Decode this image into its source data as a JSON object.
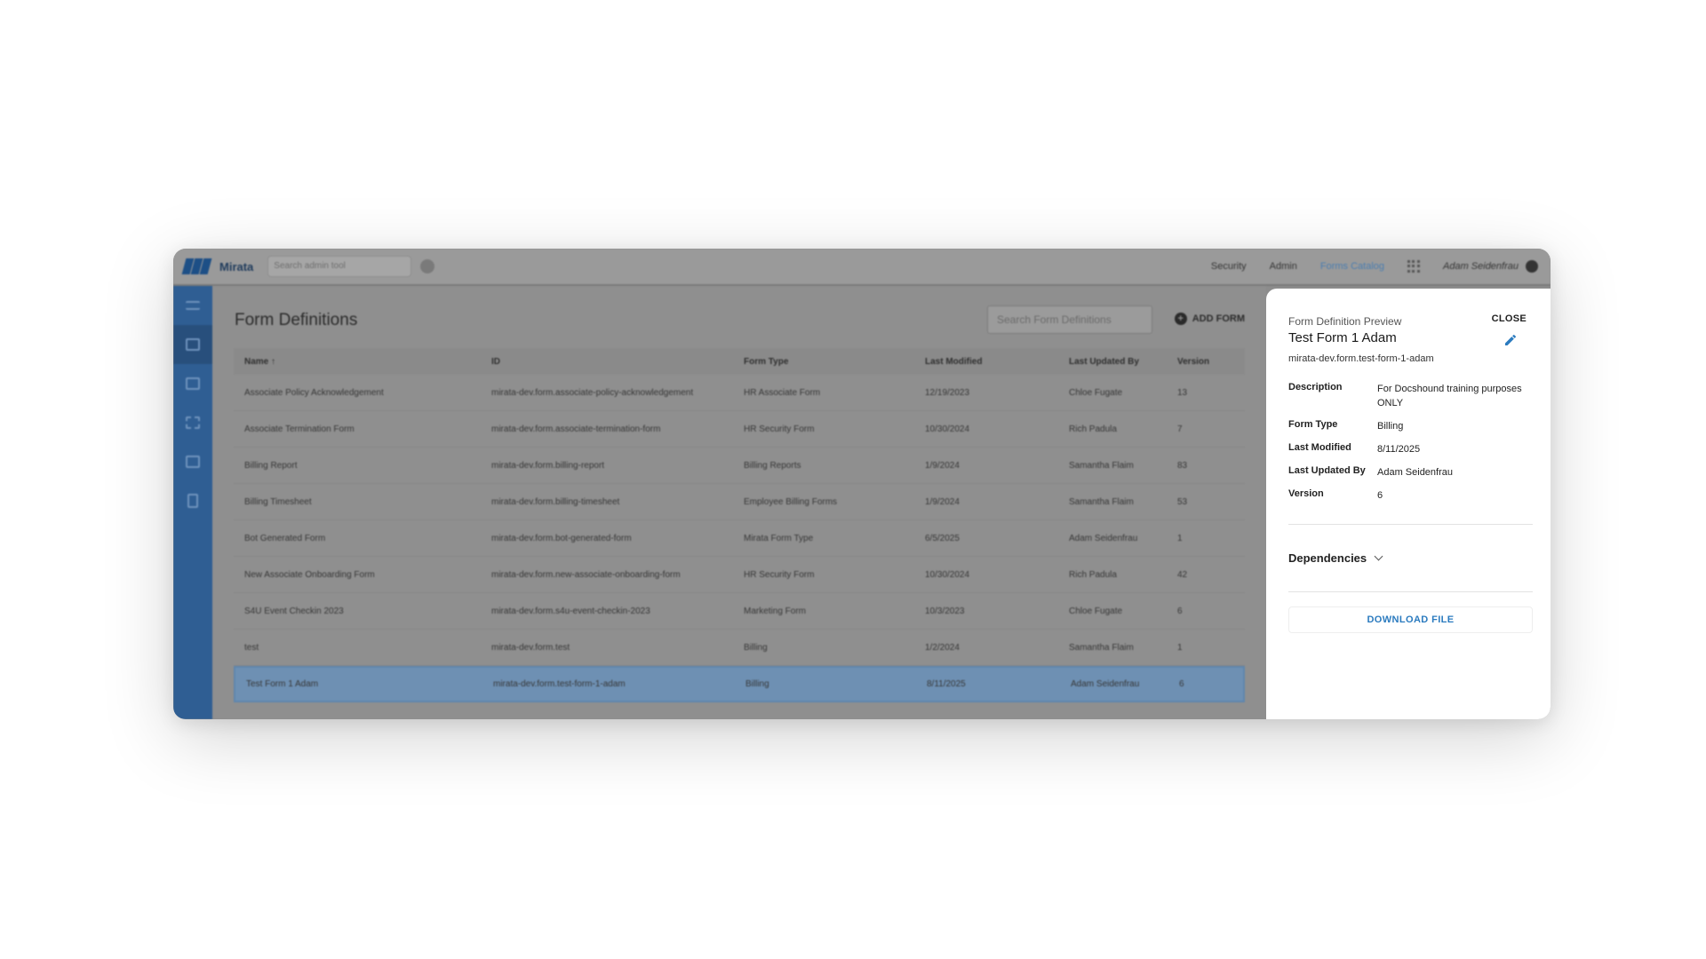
{
  "app": {
    "logo_text": "Mirata",
    "admin_search_placeholder": "Search admin tool"
  },
  "topnav": {
    "items": [
      "Security",
      "Admin",
      "Forms Catalog"
    ],
    "active": "Forms Catalog",
    "user": "Adam Seidenfrau"
  },
  "sidebar": {
    "icons": [
      "menu-icon",
      "forms-list-icon",
      "add-library-icon",
      "workflow-icon",
      "image-icon",
      "clipboard-icon"
    ]
  },
  "main": {
    "title": "Form Definitions",
    "search_placeholder": "Search Form Definitions",
    "add_form_label": "ADD FORM"
  },
  "table": {
    "columns": [
      "Name ↑",
      "ID",
      "Form Type",
      "Last Modified",
      "Last Updated By",
      "Version"
    ],
    "rows": [
      [
        "Associate Policy Acknowledgement",
        "mirata-dev.form.associate-policy-acknowledgement",
        "HR Associate Form",
        "12/19/2023",
        "Chloe Fugate",
        "13"
      ],
      [
        "Associate Termination Form",
        "mirata-dev.form.associate-termination-form",
        "HR Security Form",
        "10/30/2024",
        "Rich Padula",
        "7"
      ],
      [
        "Billing Report",
        "mirata-dev.form.billing-report",
        "Billing Reports",
        "1/9/2024",
        "Samantha Flaim",
        "83"
      ],
      [
        "Billing Timesheet",
        "mirata-dev.form.billing-timesheet",
        "Employee Billing Forms",
        "1/9/2024",
        "Samantha Flaim",
        "53"
      ],
      [
        "Bot Generated Form",
        "mirata-dev.form.bot-generated-form",
        "Mirata Form Type",
        "6/5/2025",
        "Adam Seidenfrau",
        "1"
      ],
      [
        "New Associate Onboarding Form",
        "mirata-dev.form.new-associate-onboarding-form",
        "HR Security Form",
        "10/30/2024",
        "Rich Padula",
        "42"
      ],
      [
        "S4U Event Checkin 2023",
        "mirata-dev.form.s4u-event-checkin-2023",
        "Marketing Form",
        "10/3/2023",
        "Chloe Fugate",
        "6"
      ],
      [
        "test",
        "mirata-dev.form.test",
        "Billing",
        "1/2/2024",
        "Samantha Flaim",
        "1"
      ],
      [
        "Test Form 1 Adam",
        "mirata-dev.form.test-form-1-adam",
        "Billing",
        "8/11/2025",
        "Adam Seidenfrau",
        "6"
      ]
    ],
    "selected_index": 8
  },
  "preview": {
    "eyebrow": "Form Definition Preview",
    "title": "Test Form 1 Adam",
    "id": "mirata-dev.form.test-form-1-adam",
    "close_label": "CLOSE",
    "details": [
      {
        "key": "Description",
        "value": "For Docshound training purposes ONLY"
      },
      {
        "key": "Form Type",
        "value": "Billing"
      },
      {
        "key": "Last Modified",
        "value": "8/11/2025"
      },
      {
        "key": "Last Updated By",
        "value": "Adam Seidenfrau"
      },
      {
        "key": "Version",
        "value": "6"
      }
    ],
    "dependencies_label": "Dependencies",
    "download_label": "DOWNLOAD FILE"
  },
  "colors": {
    "accent": "#2b7bbf",
    "sidebar": "#2f5e93",
    "selected_row": "#6e90b3"
  }
}
